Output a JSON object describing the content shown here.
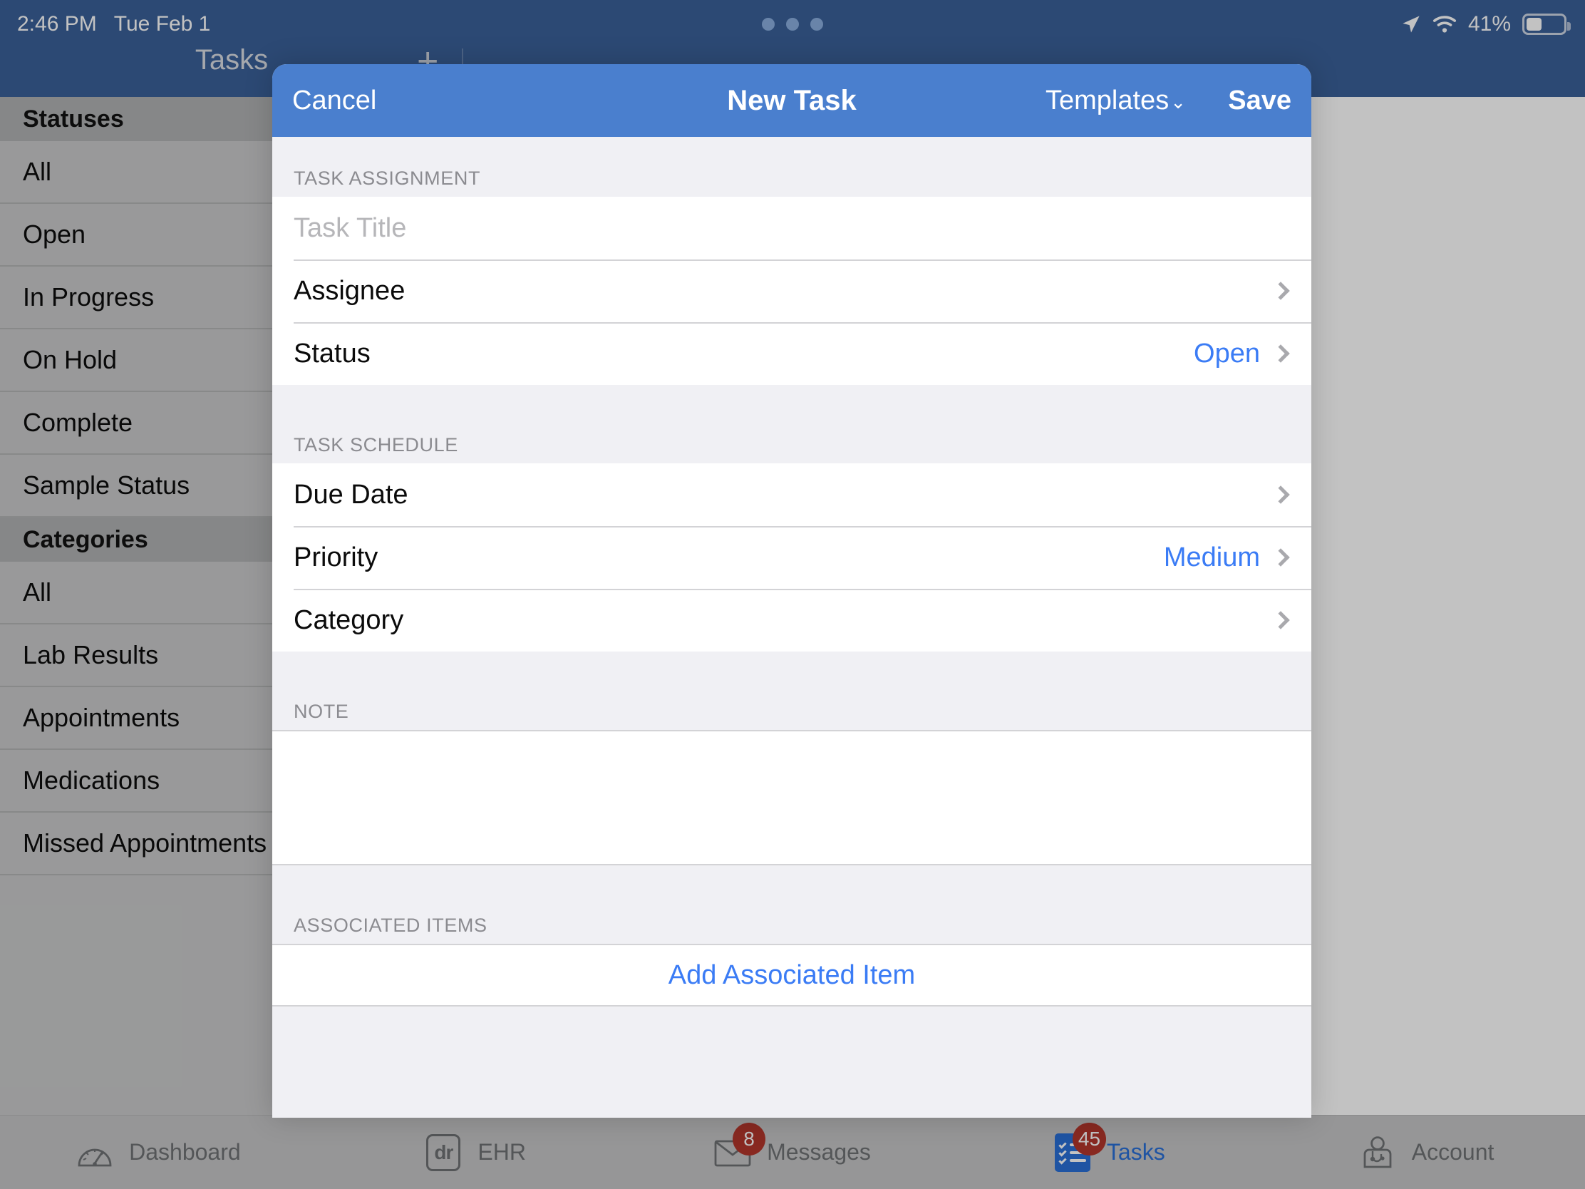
{
  "status_bar": {
    "time": "2:46 PM",
    "date": "Tue Feb 1",
    "battery_percent": "41%",
    "icons": [
      "location-arrow-icon",
      "wifi-icon",
      "battery-icon"
    ],
    "multitask_indicator": "three-dots"
  },
  "app_nav": {
    "title": "Tasks",
    "add_label": "+"
  },
  "sidebar": {
    "sections": [
      {
        "header": "Statuses",
        "items": [
          "All",
          "Open",
          "In Progress",
          "On Hold",
          "Complete",
          "Sample Status"
        ]
      },
      {
        "header": "Categories",
        "items": [
          "All",
          "Lab Results",
          "Appointments",
          "Medications",
          "Missed Appointments"
        ]
      }
    ]
  },
  "modal": {
    "header": {
      "cancel": "Cancel",
      "title": "New Task",
      "templates": "Templates",
      "templates_chevron": "chevron-down-icon",
      "save": "Save"
    },
    "sections": [
      {
        "header": "TASK ASSIGNMENT",
        "rows": [
          {
            "type": "input",
            "placeholder": "Task Title",
            "value": ""
          },
          {
            "type": "nav",
            "label": "Assignee",
            "value": ""
          },
          {
            "type": "nav",
            "label": "Status",
            "value": "Open"
          }
        ]
      },
      {
        "header": "TASK SCHEDULE",
        "rows": [
          {
            "type": "nav",
            "label": "Due Date",
            "value": ""
          },
          {
            "type": "nav",
            "label": "Priority",
            "value": "Medium"
          },
          {
            "type": "nav",
            "label": "Category",
            "value": ""
          }
        ]
      },
      {
        "header": "NOTE",
        "rows": [
          {
            "type": "textarea",
            "placeholder": "",
            "value": ""
          }
        ]
      },
      {
        "header": "ASSOCIATED ITEMS",
        "rows": [
          {
            "type": "button",
            "label": "Add Associated Item"
          }
        ]
      }
    ]
  },
  "tab_bar": {
    "tabs": [
      {
        "label": "Dashboard",
        "icon": "gauge-icon",
        "badge": "",
        "active": false
      },
      {
        "label": "EHR",
        "icon": "dr-box-icon",
        "badge": "",
        "active": false
      },
      {
        "label": "Messages",
        "icon": "envelope-icon",
        "badge": "8",
        "active": false
      },
      {
        "label": "Tasks",
        "icon": "checklist-icon",
        "badge": "45",
        "active": true
      },
      {
        "label": "Account",
        "icon": "doctor-icon",
        "badge": "",
        "active": false
      }
    ]
  },
  "colors": {
    "status_bar_blue": "#3a6099",
    "modal_header_blue": "#4a7fce",
    "accent_blue": "#3b7cf5",
    "badge_red": "#b3362c",
    "sidebar_gray": "#c9cacb",
    "section_bg": "#f0f0f4"
  }
}
